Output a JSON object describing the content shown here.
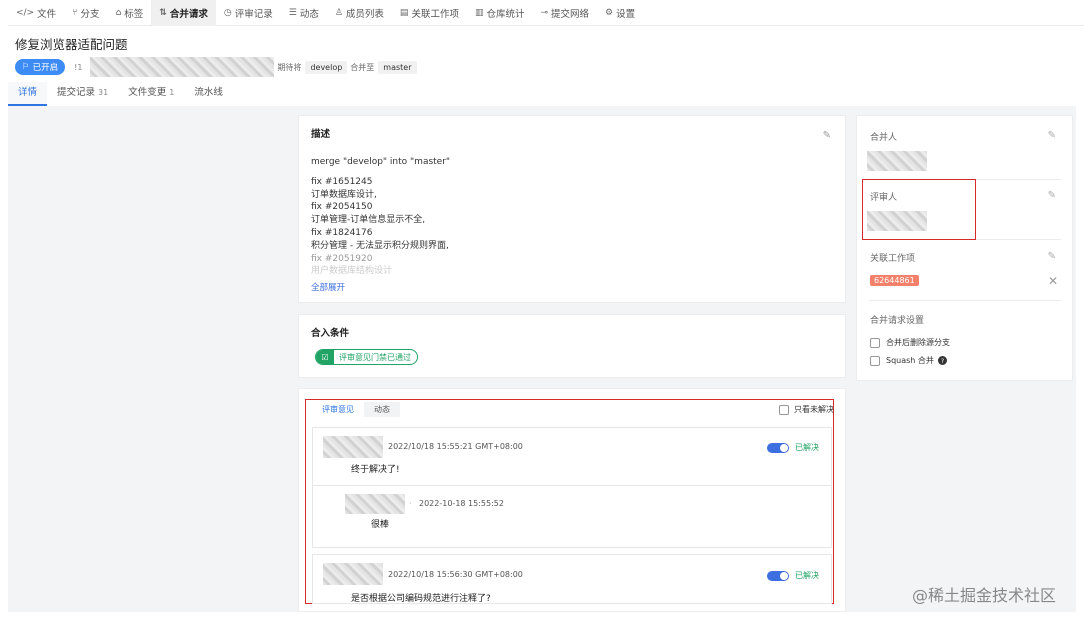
{
  "topnav": [
    {
      "icon": "</>",
      "label": "文件",
      "active": false
    },
    {
      "icon": "⑂",
      "label": "分支",
      "active": false
    },
    {
      "icon": "⌂",
      "label": "标签",
      "active": false
    },
    {
      "icon": "⇅",
      "label": "合并请求",
      "active": true
    },
    {
      "icon": "◷",
      "label": "评审记录",
      "active": false
    },
    {
      "icon": "☰",
      "label": "动态",
      "active": false
    },
    {
      "icon": "♙",
      "label": "成员列表",
      "active": false
    },
    {
      "icon": "▤",
      "label": "关联工作项",
      "active": false
    },
    {
      "icon": "▥",
      "label": "仓库统计",
      "active": false
    },
    {
      "icon": "⊸",
      "label": "提交网络",
      "active": false
    },
    {
      "icon": "⚙",
      "label": "设置",
      "active": false
    }
  ],
  "title": "修复浏览器适配问题",
  "meta": {
    "status": "已开启",
    "mr_id": "!1",
    "want_text": "期待将",
    "source_branch": "develop",
    "merge_to_text": "合并至",
    "target_branch": "master"
  },
  "subtabs": [
    {
      "label": "详情",
      "count": "",
      "active": true
    },
    {
      "label": "提交记录",
      "count": "31",
      "active": false
    },
    {
      "label": "文件变更",
      "count": "1",
      "active": false
    },
    {
      "label": "流水线",
      "count": "",
      "active": false
    }
  ],
  "description": {
    "heading": "描述",
    "intro": "merge \"develop\" into \"master\"",
    "lines": [
      "fix #1651245",
      "订单数据库设计,",
      "fix #2054150",
      "订单管理-订单信息显示不全,",
      "fix #1824176",
      "积分管理 - 无法显示积分规则界面,",
      "fix #2051920",
      "用户数据库结构设计"
    ],
    "expand": "全部展开"
  },
  "conditions": {
    "heading": "合入条件",
    "pill": "评审意见门禁已通过"
  },
  "review": {
    "tab_comments": "评审意见",
    "tab_activity": "动态",
    "only_unresolved": "只看未解决",
    "comments": [
      {
        "time": "2022/10/18 15:55:21 GMT+08:00",
        "text": "终于解决了!",
        "status": "已解决"
      },
      {
        "time": "2022/10/18 15:56:30 GMT+08:00",
        "text": "是否根据公司编码规范进行注释了?",
        "status": "已解决"
      }
    ],
    "reply": {
      "sep": "·",
      "time": "2022-10-18 15:55:52",
      "text": "很棒"
    }
  },
  "side": {
    "merger_label": "合并人",
    "reviewer_label": "评审人",
    "workitem_label": "关联工作项",
    "workitem_id": "62644861",
    "settings_label": "合并请求设置",
    "opt_delete_branch": "合并后删除源分支",
    "opt_squash": "Squash 合并",
    "squash_help": "?"
  },
  "watermark": "@稀土掘金技术社区"
}
